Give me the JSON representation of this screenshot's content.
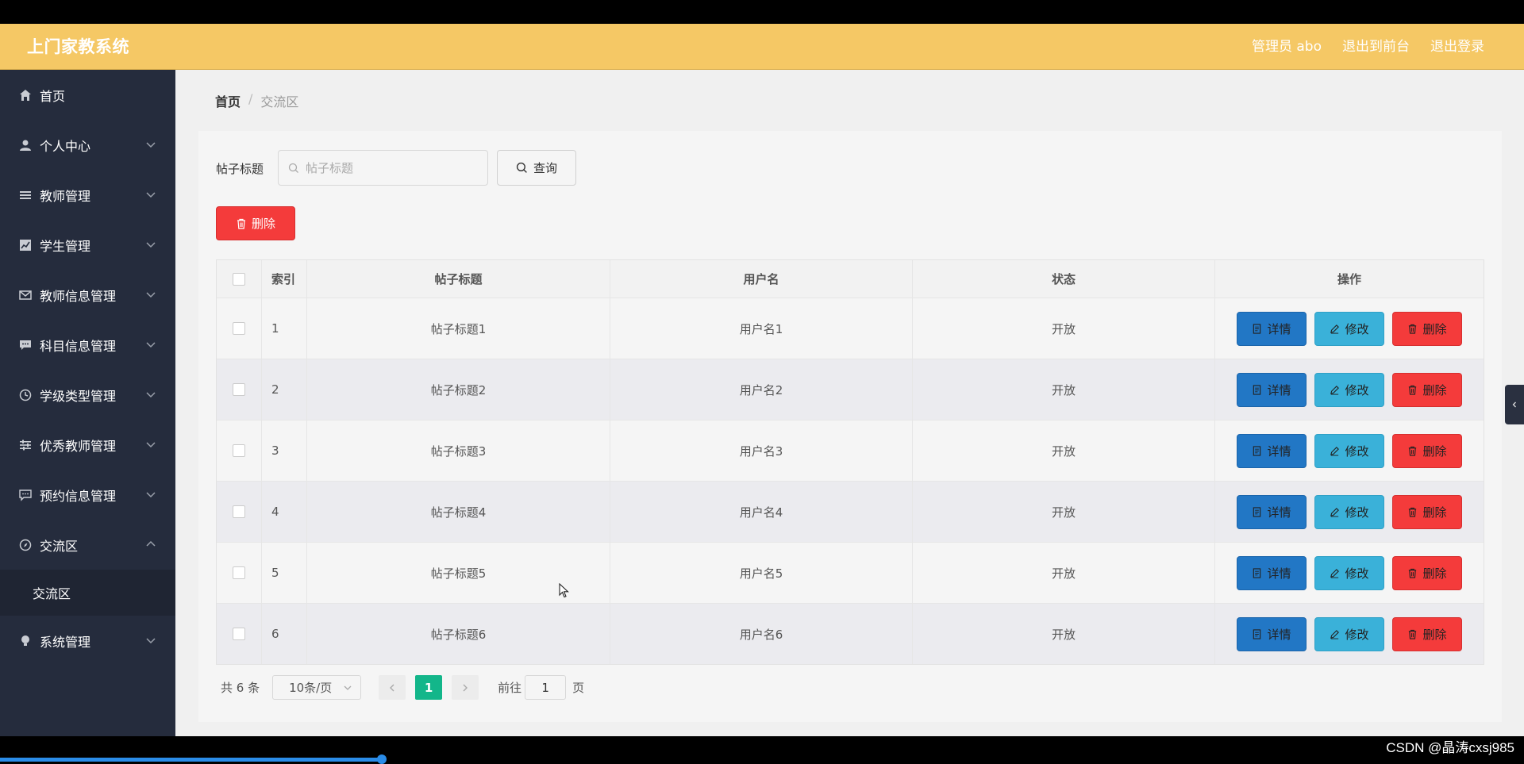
{
  "app": {
    "title": "上门家教系统"
  },
  "header": {
    "user": "管理员 abo",
    "to_front": "退出到前台",
    "logout": "退出登录"
  },
  "sidebar": {
    "items": [
      {
        "label": "首页",
        "icon": "home-icon"
      },
      {
        "label": "个人中心",
        "icon": "user-icon"
      },
      {
        "label": "教师管理",
        "icon": "list-icon"
      },
      {
        "label": "学生管理",
        "icon": "chart-icon"
      },
      {
        "label": "教师信息管理",
        "icon": "mail-icon"
      },
      {
        "label": "科目信息管理",
        "icon": "chat-icon"
      },
      {
        "label": "学级类型管理",
        "icon": "clock-icon"
      },
      {
        "label": "优秀教师管理",
        "icon": "sliders-icon"
      },
      {
        "label": "预约信息管理",
        "icon": "message-icon"
      },
      {
        "label": "交流区",
        "icon": "compass-icon"
      },
      {
        "label": "系统管理",
        "icon": "bulb-icon"
      }
    ],
    "sub_active": "交流区"
  },
  "breadcrumb": {
    "home": "首页",
    "sep": "/",
    "current": "交流区"
  },
  "search": {
    "label": "帖子标题",
    "placeholder": "帖子标题",
    "query_btn": "查询"
  },
  "toolbar": {
    "delete_btn": "删除"
  },
  "table": {
    "headers": {
      "index": "索引",
      "title": "帖子标题",
      "user": "用户名",
      "status": "状态",
      "ops": "操作"
    },
    "rows": [
      {
        "index": "1",
        "title": "帖子标题1",
        "user": "用户名1",
        "status": "开放"
      },
      {
        "index": "2",
        "title": "帖子标题2",
        "user": "用户名2",
        "status": "开放"
      },
      {
        "index": "3",
        "title": "帖子标题3",
        "user": "用户名3",
        "status": "开放"
      },
      {
        "index": "4",
        "title": "帖子标题4",
        "user": "用户名4",
        "status": "开放"
      },
      {
        "index": "5",
        "title": "帖子标题5",
        "user": "用户名5",
        "status": "开放"
      },
      {
        "index": "6",
        "title": "帖子标题6",
        "user": "用户名6",
        "status": "开放"
      }
    ],
    "ops": {
      "detail": "详情",
      "edit": "修改",
      "delete": "删除"
    }
  },
  "pagination": {
    "total": "共 6 条",
    "page_size": "10条/页",
    "current": "1",
    "goto_label": "前往",
    "goto_value": "1",
    "page_unit": "页"
  },
  "colors": {
    "header_bg": "#f5c865",
    "sidebar_bg": "#252c3d",
    "danger": "#f43b3b",
    "primary": "#2277c5",
    "info": "#3ab1d9",
    "success": "#13b68a"
  },
  "watermark": "CSDN @晶涛cxsj985"
}
